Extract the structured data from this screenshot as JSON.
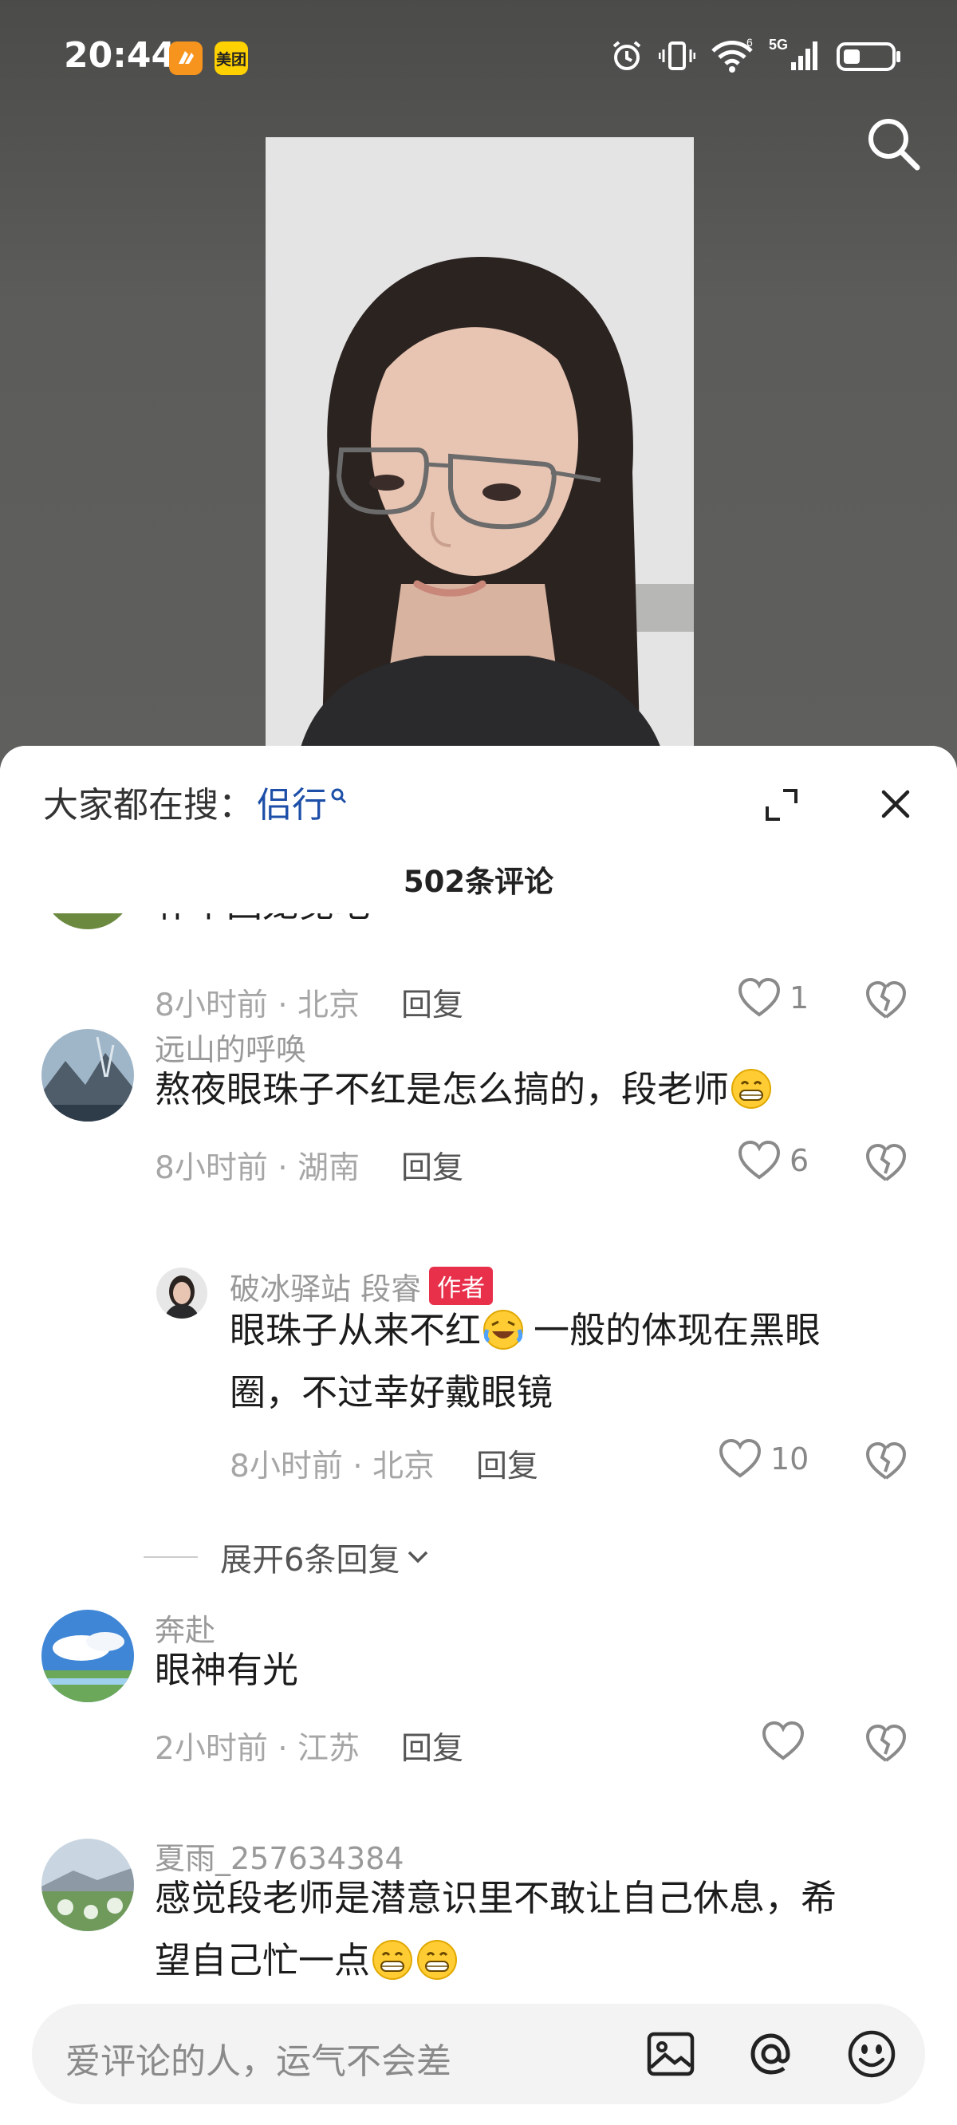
{
  "status_bar": {
    "time": "20:44",
    "badges": [
      {
        "icon": "app-icon-orange",
        "color": "#f7941d",
        "label": ""
      },
      {
        "icon": "meituan-app-icon",
        "color": "#ffd100",
        "label": "美团"
      }
    ],
    "network_label": "5G",
    "wifi_sup": "6"
  },
  "sheet": {
    "search_hint_prefix": "大家都在搜：",
    "search_keyword": "侣行",
    "comment_count": "502条评论"
  },
  "comments": [
    {
      "id": "c0",
      "partial_text": "补个回笼觉吧",
      "time": "8小时前",
      "location": "北京",
      "reply_label": "回复",
      "likes": "1"
    },
    {
      "id": "c1",
      "username": "远山的呼唤",
      "text": "熬夜眼珠子不红是怎么搞的，段老师",
      "time": "8小时前",
      "location": "湖南",
      "reply_label": "回复",
      "likes": "6"
    },
    {
      "id": "c1r",
      "username": "破冰驿站 段睿",
      "author_tag": "作者",
      "text_line1_a": "眼珠子从来不红",
      "text_line1_b": "一般的体现在黑眼",
      "text_line2": "圈，不过幸好戴眼镜",
      "time": "8小时前",
      "location": "北京",
      "reply_label": "回复",
      "likes": "10"
    },
    {
      "id": "c2",
      "username": "奔赴",
      "text": "眼神有光",
      "time": "2小时前",
      "location": "江苏",
      "reply_label": "回复",
      "likes": ""
    },
    {
      "id": "c3",
      "username": "夏雨_257634384",
      "text_line1": "感觉段老师是潜意识里不敢让自己休息，希",
      "text_line2": "望自己忙一点"
    }
  ],
  "expand_replies": "展开6条回复",
  "meta_sep": " · ",
  "input": {
    "placeholder": "爱评论的人，运气不会差"
  },
  "colors": {
    "accent_link": "#1e4fa8",
    "author_tag": "#e8304b",
    "meta_gray": "#a6a6a6"
  }
}
